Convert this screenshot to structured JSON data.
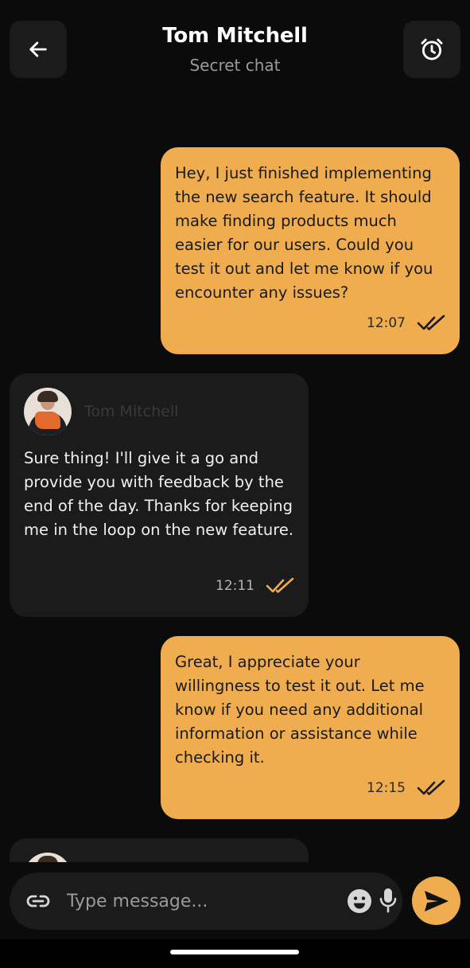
{
  "header": {
    "title": "Tom Mitchell",
    "subtitle": "Secret chat",
    "back_icon": "arrow-left-icon",
    "alarm_icon": "alarm-clock-icon"
  },
  "messages": [
    {
      "direction": "outgoing",
      "text": "Hey, I just finished implementing the new search feature. It should make finding products much easier for our users. Could you test it out and let me know if you encounter any issues?",
      "time": "12:07",
      "status_icon": "double-check-icon"
    },
    {
      "direction": "incoming",
      "sender": "Tom Mitchell",
      "text": "Sure thing! I'll give it a go and provide you with feedback by the end of the day. Thanks for keeping me in the loop on the new feature.",
      "time": "12:11",
      "status_icon": "double-check-icon"
    },
    {
      "direction": "outgoing",
      "text": "Great, I appreciate your willingness to test it out. Let me know if you need any additional information or assistance while checking it.",
      "time": "12:15",
      "status_icon": "double-check-icon"
    }
  ],
  "composer": {
    "placeholder": "Type message...",
    "value": "",
    "attach_icon": "link-icon",
    "emoji_icon": "emoji-icon",
    "mic_icon": "microphone-icon",
    "send_icon": "send-icon"
  },
  "colors": {
    "background": "#0b0b0b",
    "surface": "#1b1b1b",
    "accent": "#efad4f",
    "check_outgoing": "#1a1a1a",
    "check_incoming": "#efad4f"
  }
}
